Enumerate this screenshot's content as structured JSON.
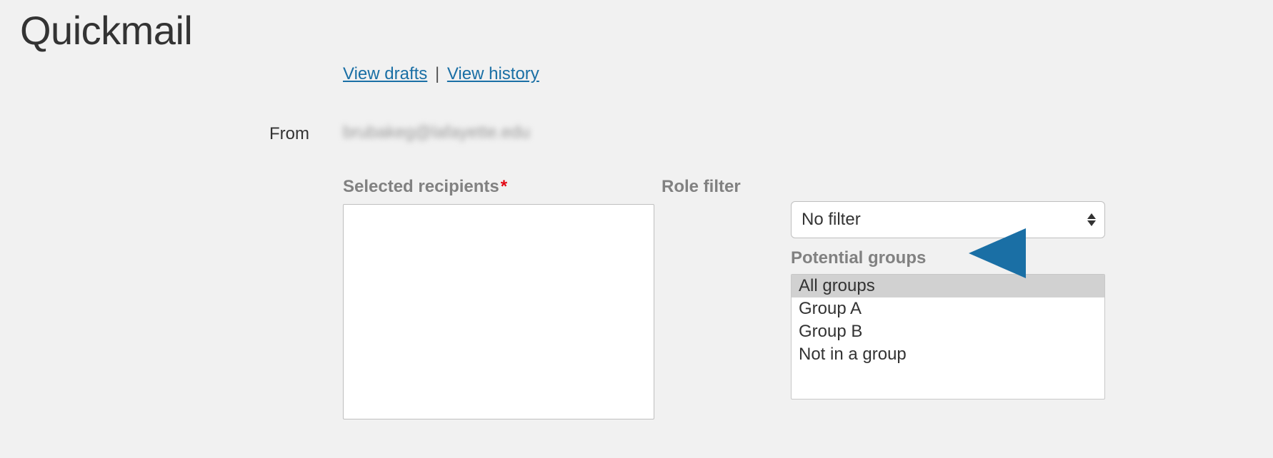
{
  "title": "Quickmail",
  "links": {
    "drafts": "View drafts",
    "history": "View history",
    "sep": "|"
  },
  "from": {
    "label": "From",
    "value_obscured": "brubakeg@lafayette.edu"
  },
  "selected": {
    "label": "Selected recipients",
    "required_marker": "*"
  },
  "role": {
    "label": "Role filter",
    "value": "No filter"
  },
  "potential_groups": {
    "label": "Potential groups",
    "items": [
      "All groups",
      "Group A",
      "Group B",
      "Not in a group"
    ],
    "selected_index": 0
  }
}
